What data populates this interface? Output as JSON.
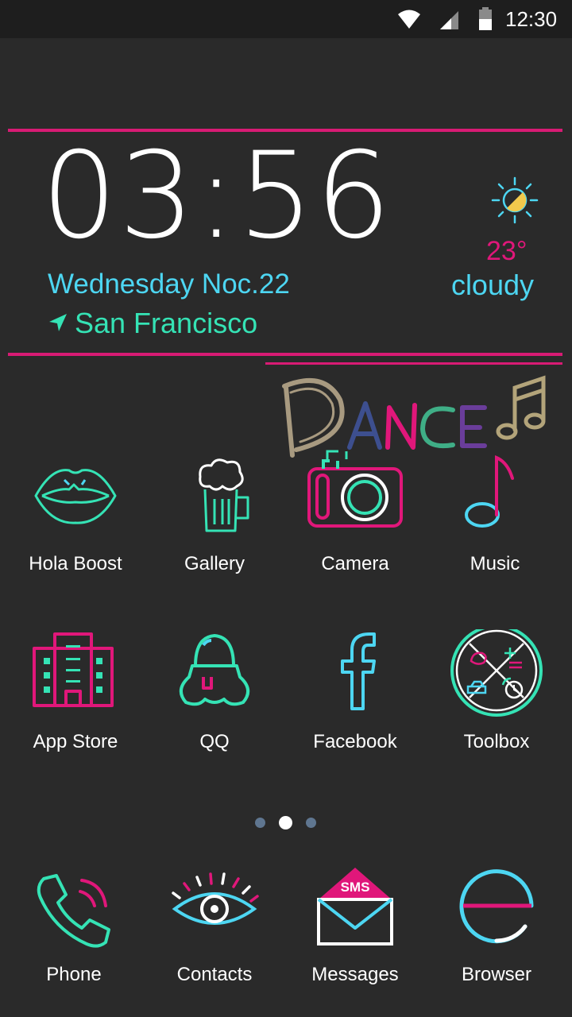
{
  "status_bar": {
    "time": "12:30",
    "icons": [
      "wifi-icon",
      "cell-signal-icon",
      "battery-icon"
    ]
  },
  "clock_widget": {
    "time": "03:56",
    "date": "Wednesday Noc.22",
    "location": "San Francisco",
    "temperature": "23°",
    "condition": "cloudy",
    "weather_icon": "partly-cloudy-sun-icon",
    "sticker_text": "DANCE"
  },
  "apps": [
    {
      "label": "Hola Boost",
      "icon": "lips-icon"
    },
    {
      "label": "Gallery",
      "icon": "beer-mug-icon"
    },
    {
      "label": "Camera",
      "icon": "camera-icon"
    },
    {
      "label": "Music",
      "icon": "music-note-icon"
    },
    {
      "label": "App Store",
      "icon": "building-icon"
    },
    {
      "label": "QQ",
      "icon": "penguin-icon"
    },
    {
      "label": "Facebook",
      "icon": "facebook-icon"
    },
    {
      "label": "Toolbox",
      "icon": "toolbox-clock-icon"
    }
  ],
  "pager": {
    "pages": 3,
    "current": 2
  },
  "dock": [
    {
      "label": "Phone",
      "icon": "phone-icon"
    },
    {
      "label": "Contacts",
      "icon": "eye-icon"
    },
    {
      "label": "Messages",
      "icon": "sms-envelope-icon",
      "badge": "SMS"
    },
    {
      "label": "Browser",
      "icon": "browser-e-icon"
    }
  ],
  "colors": {
    "background": "#2a2a2a",
    "pink": "#d81b74",
    "cyan": "#4dd6f2",
    "mint": "#35e3b5"
  }
}
